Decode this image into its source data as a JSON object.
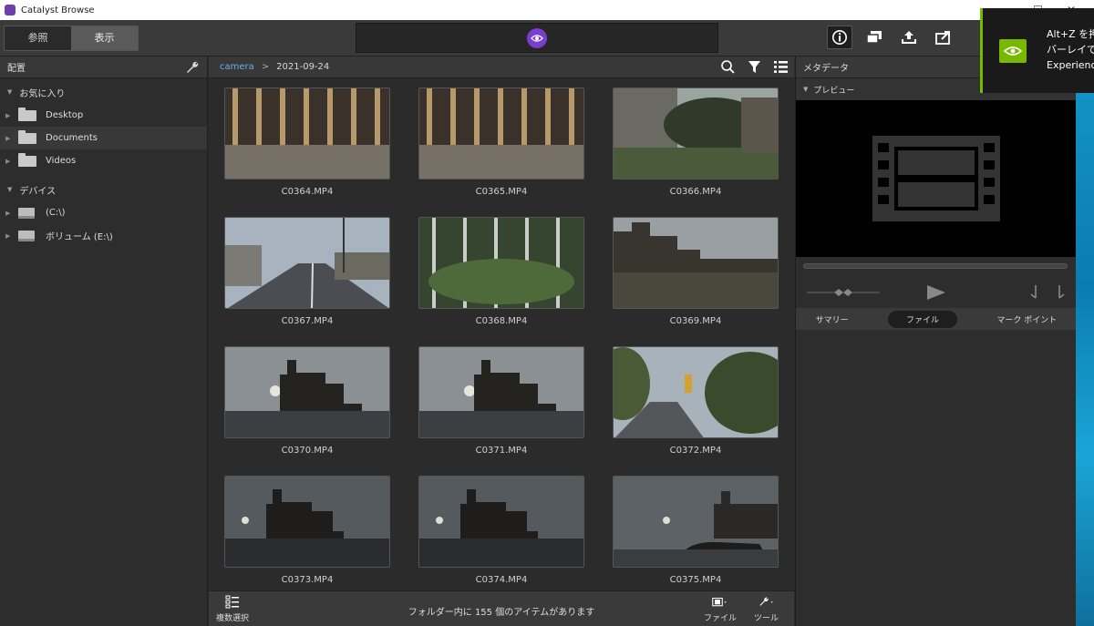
{
  "window": {
    "title": "Catalyst Browse"
  },
  "toolbar": {
    "mode_tabs": [
      {
        "label": "参照"
      },
      {
        "label": "表示"
      }
    ]
  },
  "left_panel": {
    "title": "配置",
    "favorites_label": "お気に入り",
    "favorites": [
      {
        "label": "Desktop"
      },
      {
        "label": "Documents"
      },
      {
        "label": "Videos"
      }
    ],
    "devices_label": "デバイス",
    "devices": [
      {
        "label": "(C:\\)"
      },
      {
        "label": "ボリューム (E:\\)"
      }
    ]
  },
  "breadcrumb": {
    "root": "camera",
    "separator": ">",
    "current": "2021-09-24"
  },
  "clips": [
    {
      "name": "C0364.MP4",
      "scene": "arcade"
    },
    {
      "name": "C0365.MP4",
      "scene": "arcade"
    },
    {
      "name": "C0366.MP4",
      "scene": "garden"
    },
    {
      "name": "C0367.MP4",
      "scene": "street"
    },
    {
      "name": "C0368.MP4",
      "scene": "fence"
    },
    {
      "name": "C0369.MP4",
      "scene": "castle-dusk"
    },
    {
      "name": "C0370.MP4",
      "scene": "castle-sun"
    },
    {
      "name": "C0371.MP4",
      "scene": "castle-sun"
    },
    {
      "name": "C0372.MP4",
      "scene": "road-trees"
    },
    {
      "name": "C0373.MP4",
      "scene": "castle-dark"
    },
    {
      "name": "C0374.MP4",
      "scene": "castle-dark"
    },
    {
      "name": "C0375.MP4",
      "scene": "castle-car"
    }
  ],
  "status": {
    "multi_select_label": "複数選択",
    "message": "フォルダー内に 155 個のアイテムがあります",
    "file_label": "ファイル",
    "tools_label": "ツール"
  },
  "right_panel": {
    "title": "メタデータ",
    "preview_label": "プレビュー",
    "tabs": [
      {
        "label": "サマリー"
      },
      {
        "label": "ファイル"
      },
      {
        "label": "マーク ポイント"
      }
    ]
  },
  "overlay": {
    "lines": [
      "Alt+Z を押",
      "バーレイで",
      "Experience"
    ]
  }
}
